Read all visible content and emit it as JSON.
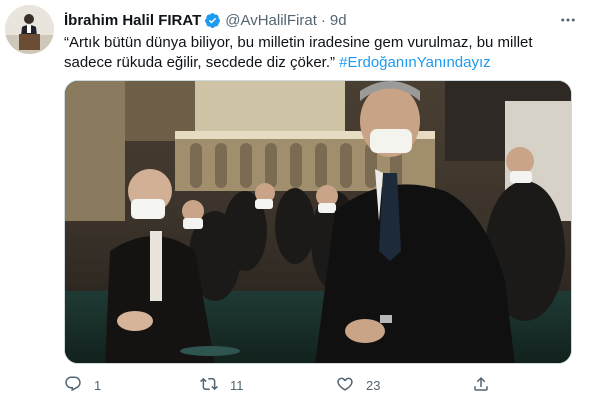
{
  "author": {
    "name": "İbrahim Halil FIRAT",
    "handle": "@AvHalilFirat",
    "separator": "·",
    "time": "9d",
    "verified_color": "#1d9bf0"
  },
  "tweet": {
    "text": "“Artık bütün dünya biliyor, bu milletin iradesine gem vurulmaz, bu millet sadece rükuda eğilir, secdede diz çöker.” ",
    "hashtag": "#ErdoğanınYanındayız"
  },
  "actions": {
    "reply_count": "1",
    "retweet_count": "11",
    "like_count": "23"
  },
  "icons": {
    "verified": "verified-badge-icon",
    "more": "more-options-icon",
    "reply": "reply-icon",
    "retweet": "retweet-icon",
    "like": "heart-icon",
    "share": "share-icon"
  },
  "colors": {
    "text_primary": "#0f1419",
    "text_secondary": "#536471",
    "link": "#1d9bf0"
  }
}
